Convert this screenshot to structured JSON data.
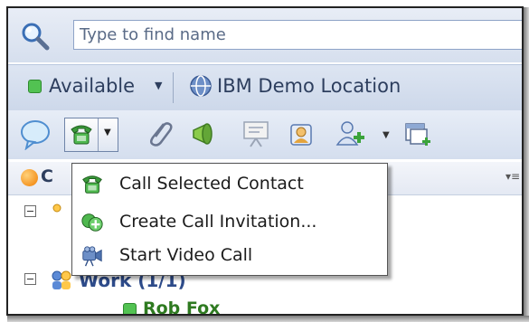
{
  "search": {
    "placeholder": "Type to find name"
  },
  "status": {
    "label": "Available",
    "location": "IBM Demo Location"
  },
  "list_header": {
    "label_visible": "C"
  },
  "groups": [
    {
      "label": "Work (1/1)"
    }
  ],
  "contacts": [
    {
      "name": "Rob Fox"
    }
  ],
  "call_menu": {
    "items": [
      {
        "label": "Call Selected Contact",
        "icon": "phone-icon"
      },
      {
        "label": "Create Call Invitation...",
        "icon": "call-invitation-icon"
      },
      {
        "label": "Start Video Call",
        "icon": "video-camera-icon"
      }
    ]
  },
  "colors": {
    "available_green": "#52c252",
    "contact_green": "#2e7a20",
    "group_blue": "#2d4b8a"
  }
}
